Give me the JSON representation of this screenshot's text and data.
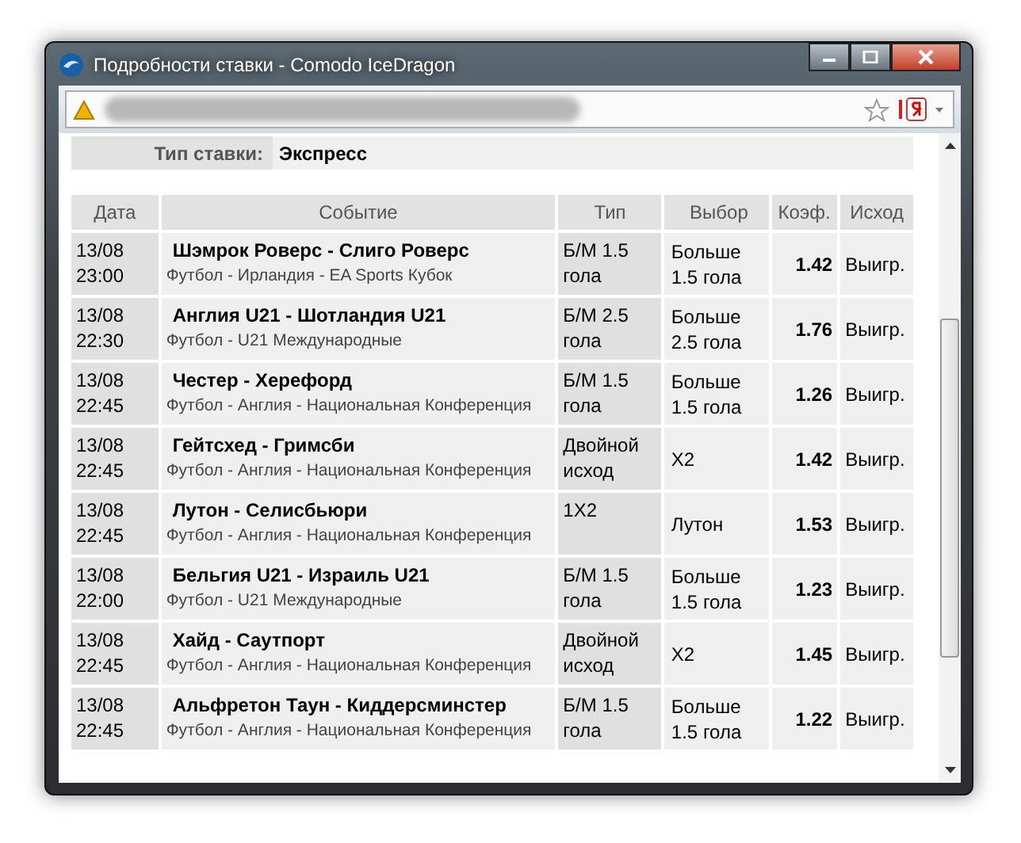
{
  "window": {
    "title": "Подробности ставки - Comodo IceDragon"
  },
  "bet_type": {
    "label": "Тип ставки:",
    "value": "Экспресс"
  },
  "table": {
    "columns": [
      "Дата",
      "Событие",
      "Тип",
      "Выбор",
      "Коэф.",
      "Исход"
    ],
    "rows": [
      {
        "date": "13/08",
        "time": "23:00",
        "event": "Шэмрок Роверс - Слиго Роверс",
        "league": "Футбол - Ирландия - EA Sports Кубок",
        "type": "Б/М 1.5 гола",
        "choice": "Больше 1.5 гола",
        "odds": "1.42",
        "result": "Выигр."
      },
      {
        "date": "13/08",
        "time": "22:30",
        "event": "Англия U21 - Шотландия U21",
        "league": "Футбол - U21 Международные",
        "type": "Б/М 2.5 гола",
        "choice": "Больше 2.5 гола",
        "odds": "1.76",
        "result": "Выигр."
      },
      {
        "date": "13/08",
        "time": "22:45",
        "event": "Честер - Херефорд",
        "league": "Футбол - Англия - Национальная Конференция",
        "type": "Б/М 1.5 гола",
        "choice": "Больше 1.5 гола",
        "odds": "1.26",
        "result": "Выигр."
      },
      {
        "date": "13/08",
        "time": "22:45",
        "event": "Гейтсхед - Гримсби",
        "league": "Футбол - Англия - Национальная Конференция",
        "type": "Двойной исход",
        "choice": "X2",
        "odds": "1.42",
        "result": "Выигр."
      },
      {
        "date": "13/08",
        "time": "22:45",
        "event": "Лутон - Селисбьюри",
        "league": "Футбол - Англия - Национальная Конференция",
        "type": "1X2",
        "choice": "Лутон",
        "odds": "1.53",
        "result": "Выигр."
      },
      {
        "date": "13/08",
        "time": "22:00",
        "event": "Бельгия U21 - Израиль U21",
        "league": "Футбол - U21 Международные",
        "type": "Б/М 1.5 гола",
        "choice": "Больше 1.5 гола",
        "odds": "1.23",
        "result": "Выигр."
      },
      {
        "date": "13/08",
        "time": "22:45",
        "event": "Хайд - Саутпорт",
        "league": "Футбол - Англия - Национальная Конференция",
        "type": "Двойной исход",
        "choice": "X2",
        "odds": "1.45",
        "result": "Выигр."
      },
      {
        "date": "13/08",
        "time": "22:45",
        "event": "Альфретон Таун - Киддерсминстер",
        "league": "Футбол - Англия - Национальная Конференция",
        "type": "Б/М 1.5 гола",
        "choice": "Больше 1.5 гола",
        "odds": "1.22",
        "result": "Выигр."
      }
    ]
  }
}
